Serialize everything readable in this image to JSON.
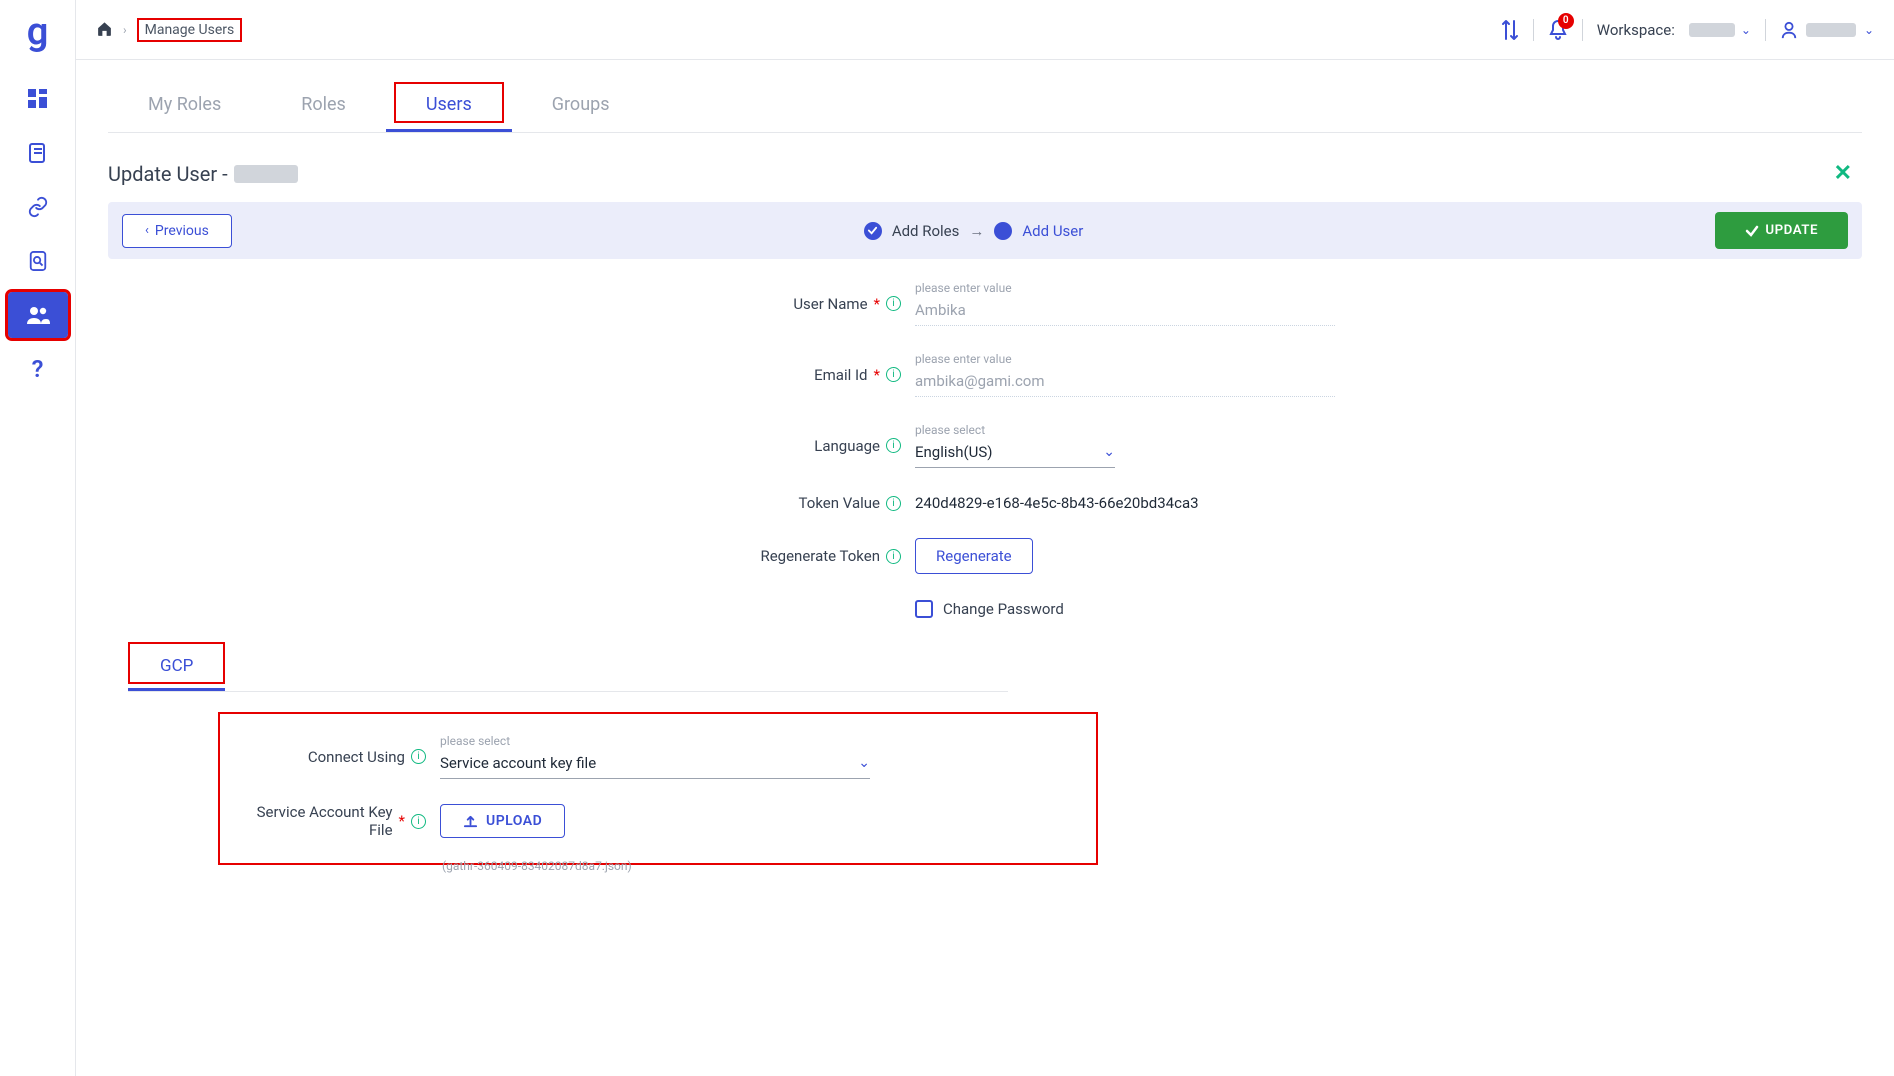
{
  "breadcrumb": {
    "item": "Manage Users"
  },
  "topbar": {
    "notification_count": "0",
    "workspace_label": "Workspace:"
  },
  "tabs": [
    {
      "label": "My Roles",
      "active": false
    },
    {
      "label": "Roles",
      "active": false
    },
    {
      "label": "Users",
      "active": true
    },
    {
      "label": "Groups",
      "active": false
    }
  ],
  "section": {
    "title_prefix": "Update User - "
  },
  "wizard": {
    "previous_label": "Previous",
    "step1_label": "Add Roles",
    "arrow": "→",
    "step2_label": "Add User",
    "update_label": "UPDATE"
  },
  "form": {
    "username": {
      "label": "User Name",
      "float": "please enter value",
      "value": "Ambika"
    },
    "email": {
      "label": "Email Id",
      "float": "please enter value",
      "value": "ambika@gami.com"
    },
    "language": {
      "label": "Language",
      "float": "please select",
      "value": "English(US)"
    },
    "token": {
      "label": "Token Value",
      "value": "240d4829-e168-4e5c-8b43-66e20bd34ca3"
    },
    "regen": {
      "label": "Regenerate Token",
      "button": "Regenerate"
    },
    "changepw": {
      "label": "Change Password"
    }
  },
  "subtabs": [
    {
      "label": "GCP",
      "active": true
    }
  ],
  "gcp": {
    "connect": {
      "label": "Connect Using",
      "float": "please select",
      "value": "Service account key file"
    },
    "keyfile": {
      "label": "Service Account Key File",
      "button": "UPLOAD",
      "hint": "(gathr-360409-83402087d8a7.json)"
    }
  }
}
